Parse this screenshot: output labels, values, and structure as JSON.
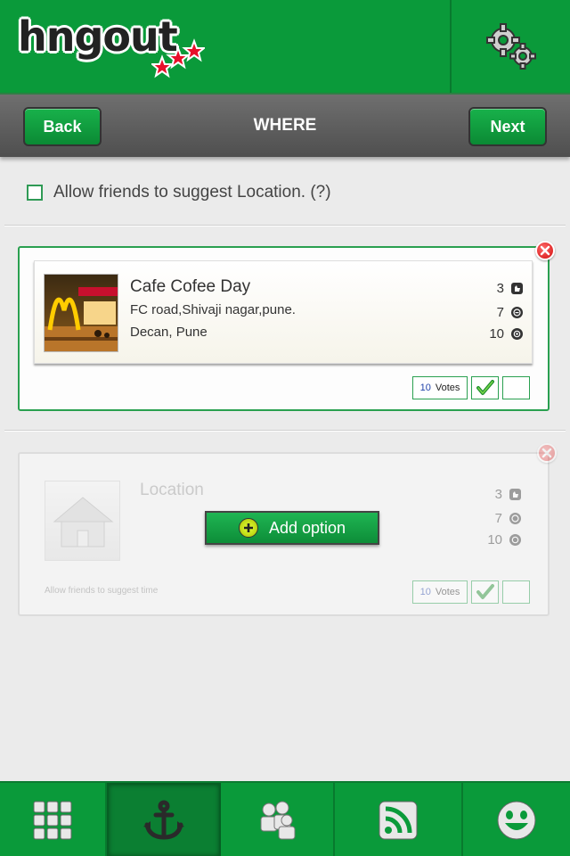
{
  "header": {
    "logo_text": "hngout",
    "settings_icon": "gear-icon"
  },
  "navbar": {
    "back_label": "Back",
    "title": "WHERE",
    "next_label": "Next"
  },
  "allow_suggest": {
    "label": "Allow friends to suggest Location. (?)",
    "checked": false
  },
  "options": [
    {
      "name": "Cafe Cofee Day",
      "address": "FC road,Shivaji nagar,pune.",
      "area": "Decan, Pune",
      "stats": [
        "3",
        "7",
        "10"
      ],
      "votes_count": "10",
      "votes_label": "Votes"
    }
  ],
  "new_option": {
    "title": "Location",
    "add_label": "Add option",
    "note": "Allow friends to suggest time",
    "stats": [
      "3",
      "7",
      "10"
    ],
    "votes_count": "10",
    "votes_label": "Votes"
  },
  "tabs": [
    "grid-icon",
    "anchor-icon",
    "people-icon",
    "rss-icon",
    "smiley-icon"
  ],
  "colors": {
    "brand_green": "#0a9a3a",
    "navbar_gray": "#5f5f5f",
    "close_red": "#d20e0e"
  }
}
